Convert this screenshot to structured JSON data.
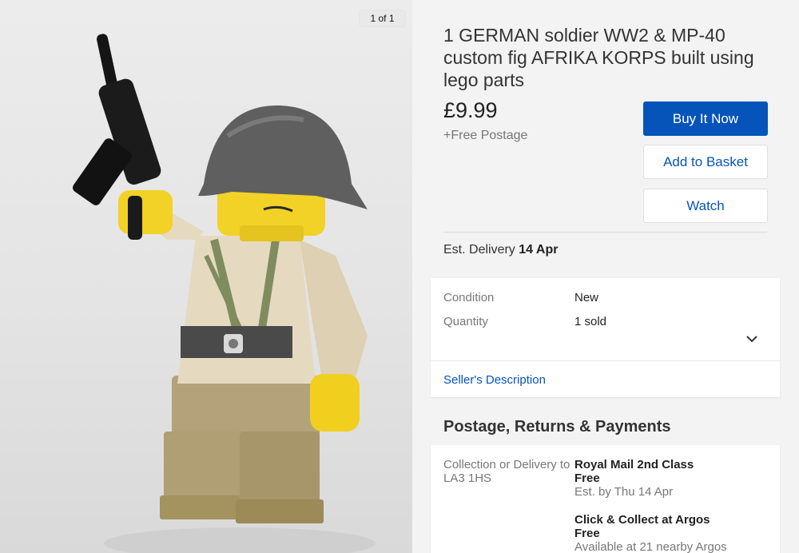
{
  "image": {
    "counter": "1 of 1"
  },
  "listing": {
    "title": "1 GERMAN soldier WW2 & MP-40 custom fig AFRIKA KORPS built using lego parts",
    "price": "£9.99",
    "postage": "+Free Postage"
  },
  "actions": {
    "buy_now": "Buy It Now",
    "add_to_basket": "Add to Basket",
    "watch": "Watch"
  },
  "delivery": {
    "label": "Est. Delivery",
    "date": "14 Apr"
  },
  "specs": {
    "condition_label": "Condition",
    "condition_value": "New",
    "quantity_label": "Quantity",
    "quantity_value": "1 sold",
    "seller_description": "Seller's Description"
  },
  "postage_section": {
    "title": "Postage, Returns & Payments",
    "location_label": "Collection or Delivery to LA3 1HS",
    "options": [
      {
        "service": "Royal Mail 2nd Class",
        "cost": "Free",
        "note": "Est. by Thu 14 Apr"
      },
      {
        "service": "Click & Collect at Argos",
        "cost": "Free",
        "note": "Available at 21 nearby Argos"
      }
    ]
  },
  "colors": {
    "accent": "#0654ba",
    "panel_bg": "#f3f3f3",
    "muted_text": "#777777"
  }
}
